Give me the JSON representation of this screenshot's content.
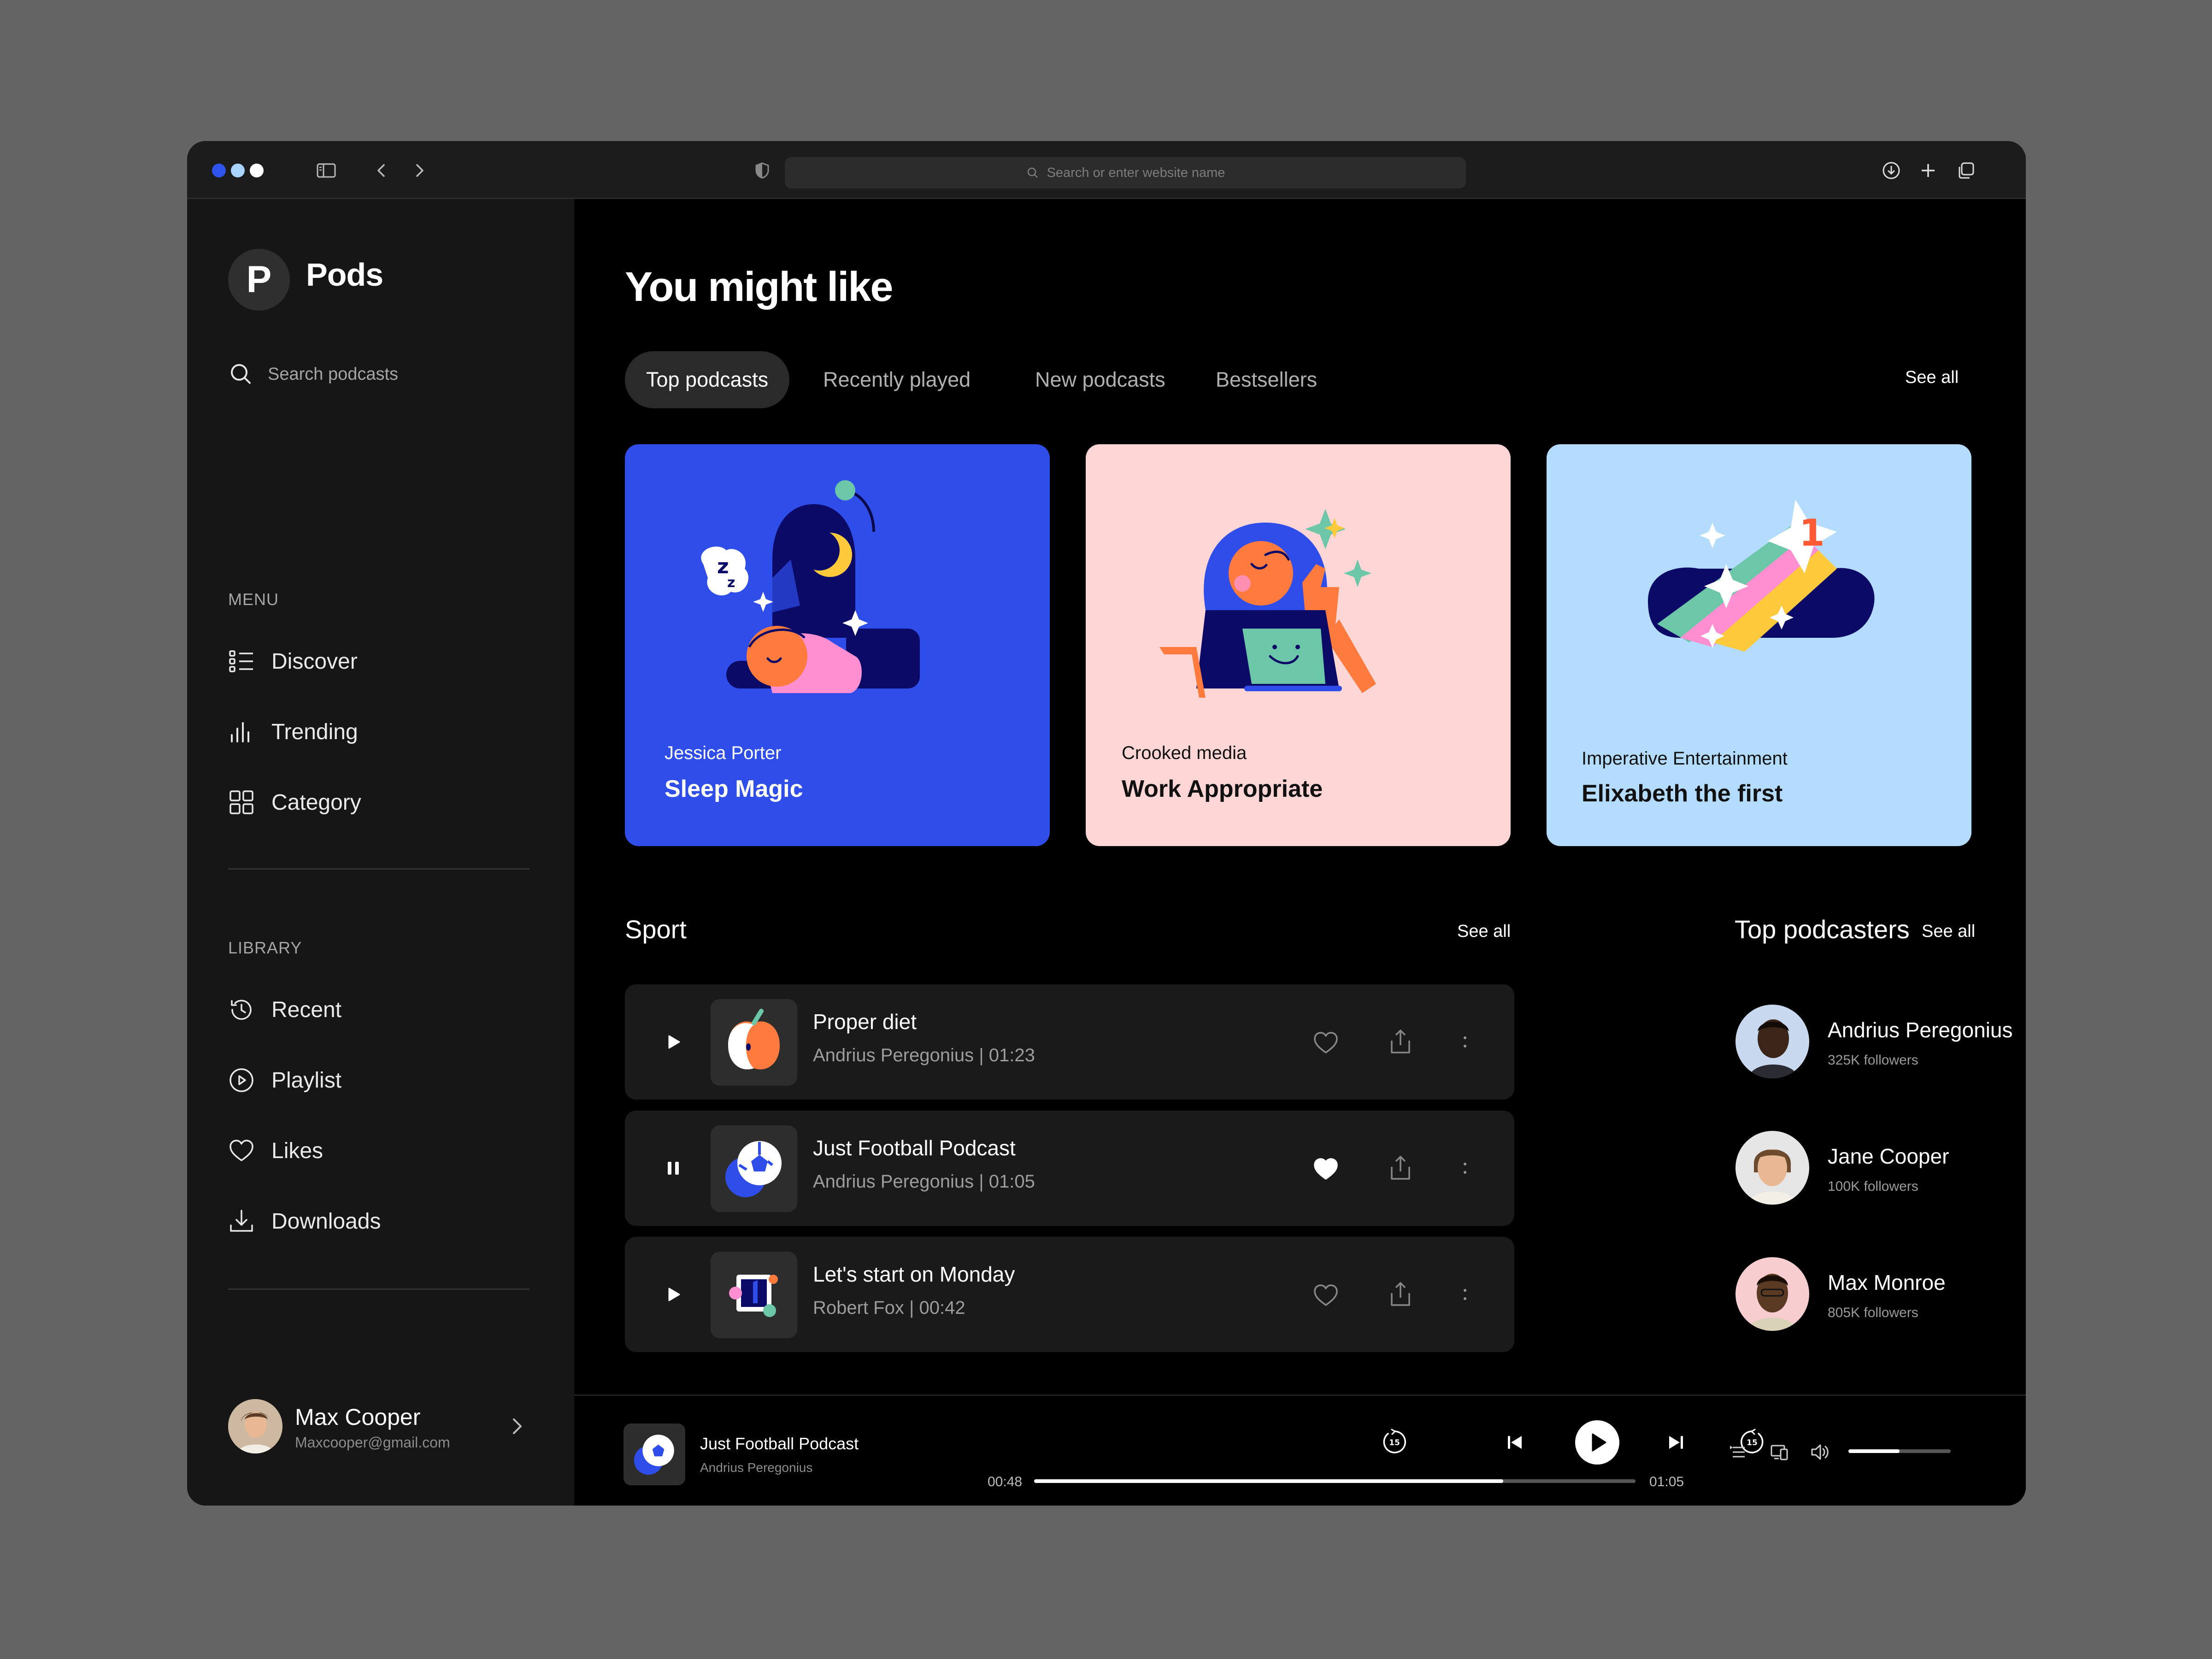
{
  "browser": {
    "url_placeholder": "Search or enter website name",
    "traffic_colors": [
      "#2f54eb",
      "#a9d4ff",
      "#ffffff"
    ]
  },
  "app": {
    "logo_letter": "P",
    "name": "Pods",
    "search_placeholder": "Search podcasts"
  },
  "menu": {
    "label": "MENU",
    "items": [
      {
        "label": "Discover",
        "icon": "list-icon"
      },
      {
        "label": "Trending",
        "icon": "bar-chart-icon"
      },
      {
        "label": "Category",
        "icon": "grid-icon"
      }
    ]
  },
  "library": {
    "label": "LIBRARY",
    "items": [
      {
        "label": "Recent",
        "icon": "history-icon"
      },
      {
        "label": "Playlist",
        "icon": "play-circle-icon"
      },
      {
        "label": "Likes",
        "icon": "heart-icon"
      },
      {
        "label": "Downloads",
        "icon": "download-icon"
      }
    ]
  },
  "user": {
    "name": "Max Cooper",
    "email": "Maxcooper@gmail.com"
  },
  "main": {
    "heading": "You might like",
    "tabs": [
      "Top podcasts",
      "Recently played",
      "New podcasts",
      "Bestsellers"
    ],
    "active_tab": "Top podcasts",
    "see_all": "See all"
  },
  "cards": [
    {
      "author": "Jessica Porter",
      "title": "Sleep Magic",
      "bg": "#2f4de8",
      "text_color": "#ffffff"
    },
    {
      "author": "Crooked media",
      "title": "Work Appropriate",
      "bg": "#ffd6d6",
      "text_color": "#111111"
    },
    {
      "author": "Imperative Entertainment",
      "title": "Elixabeth the first",
      "bg": "#b3dcff",
      "text_color": "#111111"
    }
  ],
  "sport": {
    "title": "Sport",
    "see_all": "See all",
    "episodes": [
      {
        "title": "Proper diet",
        "author": "Andrius Peregonius",
        "duration": "01:23",
        "sub": "Andrius Peregonius  |  01:23",
        "playing": false,
        "liked": false
      },
      {
        "title": "Just Football Podcast",
        "author": "Andrius Peregonius",
        "duration": "01:05",
        "sub": "Andrius Peregonius  |  01:05",
        "playing": true,
        "liked": true
      },
      {
        "title": "Let's start on Monday",
        "author": "Robert Fox",
        "duration": "00:42",
        "sub": "Robert Fox  | 00:42",
        "playing": false,
        "liked": false
      }
    ]
  },
  "podcasters": {
    "title": "Top podcasters",
    "see_all": "See all",
    "items": [
      {
        "name": "Andrius Peregonius",
        "followers": "325K followers",
        "avatar_bg": "#c8d8ee"
      },
      {
        "name": "Jane Cooper",
        "followers": "100K followers",
        "avatar_bg": "#e6e6e6"
      },
      {
        "name": "Max Monroe",
        "followers": "805K followers",
        "avatar_bg": "#f7cdd0"
      }
    ]
  },
  "player": {
    "title": "Just Football Podcast",
    "artist": "Andrius Peregonius",
    "current_time": "00:48",
    "duration": "01:05",
    "progress": 0.78,
    "volume": 0.5,
    "skip_seconds": "15"
  }
}
